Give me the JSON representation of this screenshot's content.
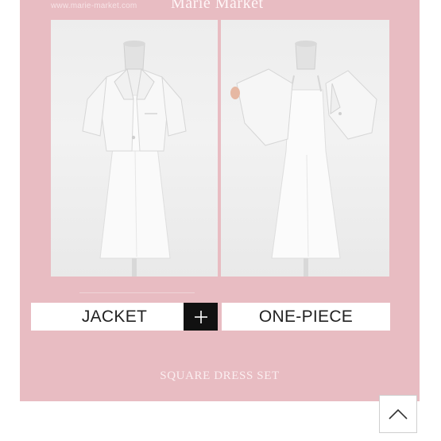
{
  "header": {
    "site_url": "www.marie-market.com",
    "brand": "Marie Market"
  },
  "product": {
    "left_photo_alt": "",
    "right_photo_alt": "",
    "label_left": "JACKET",
    "label_right": "ONE-PIECE",
    "combine_symbol": "+",
    "subtitle": "SQUARE DRESS SET"
  },
  "colors": {
    "panel": "#e8bcc2",
    "photo_bg": "#efefef",
    "plus_bg": "#111111"
  },
  "icons": {
    "scroll_top": "chevron-up-icon",
    "plus": "plus-icon"
  }
}
